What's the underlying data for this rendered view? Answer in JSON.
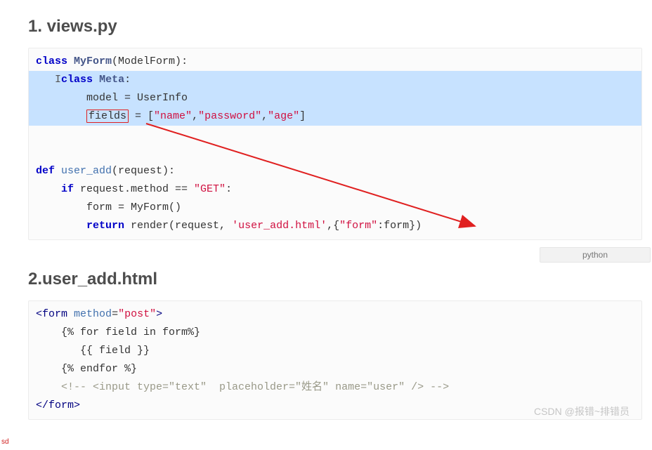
{
  "heading1": "1. views.py",
  "heading2": "2.user_add.html",
  "code1": {
    "l1_class": "class",
    "l1_name": "MyForm",
    "l1_open": "(ModelForm):",
    "l2_cursor": "I",
    "l2_class": "class",
    "l2_name": "Meta",
    "l2_colon": ":",
    "l3_pre": "        model = UserInfo",
    "l4_indent": "        ",
    "l4_fields": "fields",
    "l4_eq": " = [",
    "l4_s1": "\"name\"",
    "l4_c1": ",",
    "l4_s2": "\"password\"",
    "l4_c2": ",",
    "l4_s3": "\"age\"",
    "l4_close": "]",
    "l6_def": "def",
    "l6_fn": "user_add",
    "l6_args": "(request):",
    "l7": "    if",
    "l7b": " request.method == ",
    "l7s": "\"GET\"",
    "l7c": ":",
    "l8": "        form = MyForm()",
    "l9a": "        return",
    "l9b": " render(request, ",
    "l9s1": "'user_add.html'",
    "l9c": ",{",
    "l9s2": "\"form\"",
    "l9d": ":form})",
    "lang": "python"
  },
  "code2": {
    "l1_open": "<",
    "l1_tag": "form",
    "l1_sp": " ",
    "l1_attr": "method",
    "l1_eq": "=",
    "l1_val": "\"post\"",
    "l1_close": ">",
    "l2": "    {% for field in form%}",
    "l3": "       {{ field }}",
    "l4": "    {% endfor %}",
    "l5": "    <!-- <input type=\"text\"  placeholder=\"姓名\" name=\"user\" /> -->",
    "l6_open": "</",
    "l6_tag": "form",
    "l6_close": ">"
  },
  "watermark": "CSDN @报错~排错员",
  "corner": "sd"
}
